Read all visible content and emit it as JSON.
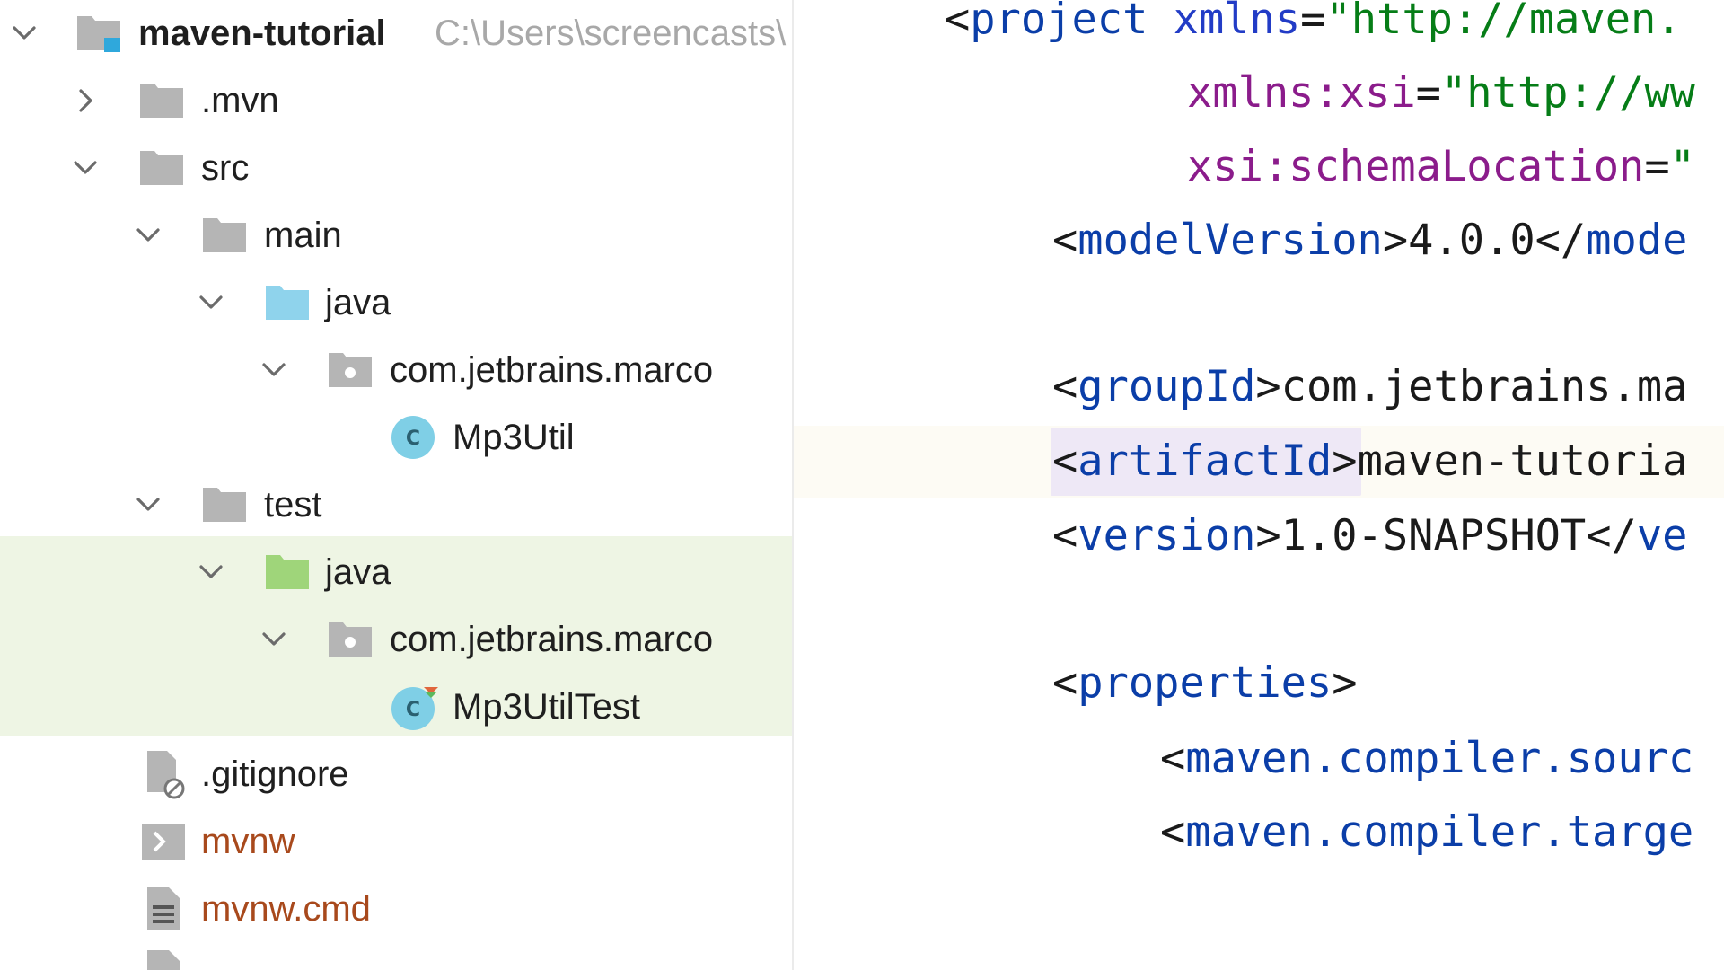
{
  "project_tree": {
    "root": {
      "name": "maven-tutorial",
      "path": "C:\\Users\\screencasts\\"
    },
    "items": [
      {
        "label": ".mvn"
      },
      {
        "label": "src"
      },
      {
        "label": "main"
      },
      {
        "label": "java"
      },
      {
        "label": "com.jetbrains.marco"
      },
      {
        "label": "Mp3Util"
      },
      {
        "label": "test"
      },
      {
        "label": "java"
      },
      {
        "label": "com.jetbrains.marco"
      },
      {
        "label": "Mp3UtilTest"
      },
      {
        "label": ".gitignore"
      },
      {
        "label": "mvnw"
      },
      {
        "label": "mvnw.cmd"
      }
    ]
  },
  "editor": {
    "line1": {
      "bracket": "<",
      "tag": "project",
      "attr": "xmlns",
      "eq": "=",
      "value": "\"http://maven."
    },
    "line2": {
      "ns": "xmlns:xsi",
      "eq": "=",
      "value": "\"http://ww"
    },
    "line3": {
      "ns": "xsi:schemaLocation",
      "eq": "=",
      "value": "\""
    },
    "line4": {
      "open": "<",
      "tag": "modelVersion",
      "gt": ">",
      "text": "4.0.0",
      "close": "</",
      "end_tag": "mode"
    },
    "line5": {
      "open": "<",
      "tag": "groupId",
      "gt": ">",
      "text": "com.jetbrains.ma"
    },
    "line6": {
      "open": "<",
      "tag": "artifactId",
      "gt": ">",
      "text": "maven-tutoria"
    },
    "line7": {
      "open": "<",
      "tag": "version",
      "gt": ">",
      "text": "1.0-SNAPSHOT",
      "close": "</",
      "end_tag": "ve"
    },
    "line8": {
      "open": "<",
      "tag": "properties",
      "gt": ">"
    },
    "line9": {
      "open": "<",
      "tag": "maven.compiler.sourc"
    },
    "line10": {
      "open": "<",
      "tag": "maven.compiler.targe"
    }
  },
  "colors": {
    "tag": "#0b3ea8",
    "attribute": "#223cc6",
    "namespace": "#8b1c8b",
    "string": "#067d17",
    "folder": "#b5b5b5",
    "source_folder": "#8fd3ec",
    "test_folder": "#9fd57a",
    "class_icon": "#7fcfe6",
    "test_highlight": "#eef5e4",
    "excluded_file": "#a8491c"
  }
}
